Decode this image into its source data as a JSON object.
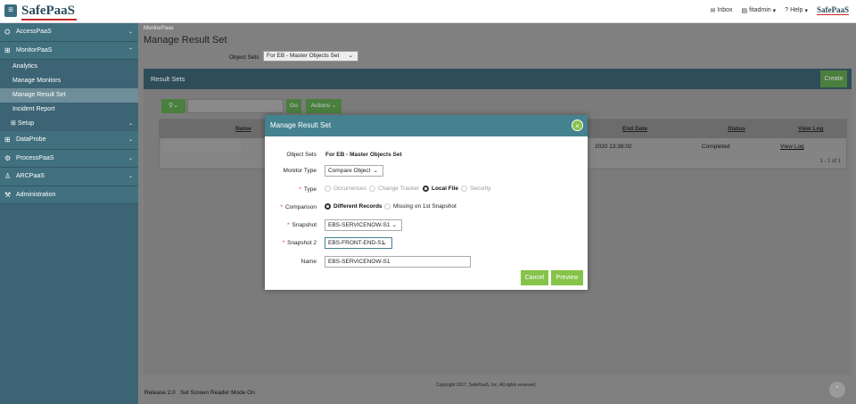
{
  "header": {
    "logo": "SafePaaS",
    "inbox_label": "Inbox",
    "user_label": "fitadmin",
    "help_label": "Help",
    "mini_logo": "SafePaaS"
  },
  "sidebar": {
    "items": [
      {
        "label": "AccessPaaS",
        "icon": "access-icon"
      },
      {
        "label": "MonitorPaaS",
        "icon": "monitor-icon"
      },
      {
        "label": "DataProbe",
        "icon": "dataprobe-icon"
      },
      {
        "label": "ProcessPaaS",
        "icon": "process-icon"
      },
      {
        "label": "ARCPaaS",
        "icon": "arc-icon"
      },
      {
        "label": "Administration",
        "icon": "wrench-icon"
      }
    ],
    "sub_items": [
      "Analytics",
      "Manage Monitors",
      "Manage Result Set",
      "Incident Report",
      "Setup"
    ]
  },
  "page": {
    "breadcrumb": "MonitorPaas",
    "title": "Manage Result Set",
    "object_sets_label": "Object Sets",
    "object_sets_value": "For EB - Master Objects Set"
  },
  "result_sets": {
    "title": "Result Sets",
    "create_label": "Create",
    "go_label": "Go",
    "actions_label": "Actions",
    "columns": {
      "name": "Name",
      "end_date": "End Date",
      "status": "Status",
      "view_log": "View Log"
    },
    "row": {
      "end_date": "2020 13:38:02",
      "status": "Completed",
      "view_log": "View Log"
    },
    "pager": "1 - 1 of 1"
  },
  "footer": {
    "copyright": "Copyright 2017, SafePaaS, Inc. All rights reserved.",
    "release": "Release 2.0",
    "screen_reader": "Set Screen Reader Mode On"
  },
  "modal": {
    "title": "Manage Result Set",
    "object_sets_label": "Object Sets",
    "object_sets_value": "For EB - Master Objects Set",
    "monitor_type_label": "Monitor Type",
    "monitor_type_value": "Compare Object",
    "type_label": "Type",
    "type_options": [
      "Occurrences",
      "Change Tracker",
      "Local File",
      "Security"
    ],
    "comparison_label": "Comparison",
    "comparison_options": [
      "Different Records",
      "Missing on 1st Snapshot"
    ],
    "snapshot_label": "Snapshot",
    "snapshot_value": "EBS-SERVICENOW-S1",
    "snapshot2_label": "Snapshot 2",
    "snapshot2_value": "EBS-FRONT-END-S1",
    "name_label": "Name",
    "name_value": "EBS-SERVICENOW-S1",
    "cancel_label": "Cancel",
    "preview_label": "Preview"
  },
  "colors": {
    "accent": "#45828f",
    "button_green": "#86c34a",
    "sidebar": "#41707f"
  }
}
